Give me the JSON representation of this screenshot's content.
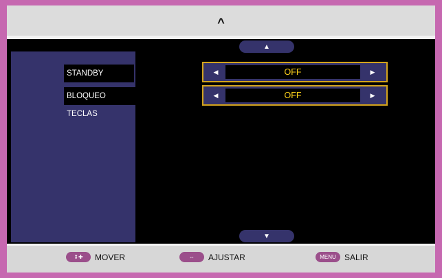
{
  "header": {
    "caret": "^"
  },
  "scroll": {
    "up_glyph": "▲",
    "down_glyph": "▼"
  },
  "menu": {
    "items": [
      {
        "label": "STANDBY",
        "value": "OFF",
        "left_arrow": "◀",
        "right_arrow": "▶"
      },
      {
        "label": "BLOQUEO TECLAS",
        "value": "OFF",
        "left_arrow": "◀",
        "right_arrow": "▶"
      }
    ]
  },
  "footer": {
    "hints": [
      {
        "key": "⇕✚",
        "label": "MOVER"
      },
      {
        "key": "⇔",
        "label": "AJUSTAR"
      },
      {
        "key": "MENU",
        "label": "SALIR"
      }
    ]
  },
  "colors": {
    "border": "#c668b0",
    "panel": "#35336b",
    "screen": "#000000",
    "highlight": "#d4a41c",
    "value_text": "#ffd21a",
    "key_pill": "#9b4f8b"
  }
}
